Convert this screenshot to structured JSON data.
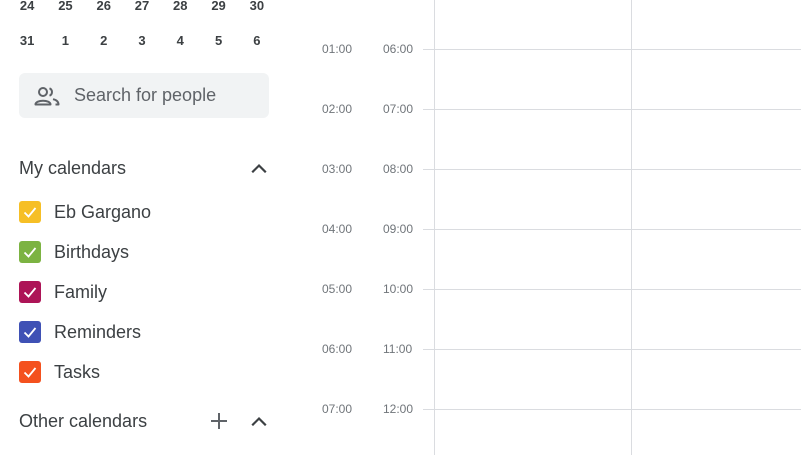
{
  "mini_calendar": {
    "rows": [
      [
        "24",
        "25",
        "26",
        "27",
        "28",
        "29",
        "30"
      ],
      [
        "31",
        "1",
        "2",
        "3",
        "4",
        "5",
        "6"
      ]
    ]
  },
  "search": {
    "placeholder": "Search for people",
    "icon": "people-icon"
  },
  "my_calendars": {
    "title": "My calendars",
    "collapse_icon": "chevron-up-icon",
    "items": [
      {
        "label": "Eb Gargano",
        "color": "#f6bf26",
        "checked": true
      },
      {
        "label": "Birthdays",
        "color": "#7cb342",
        "checked": true
      },
      {
        "label": "Family",
        "color": "#ad1457",
        "checked": true
      },
      {
        "label": "Reminders",
        "color": "#3f51b5",
        "checked": true
      },
      {
        "label": "Tasks",
        "color": "#f4511e",
        "checked": true
      }
    ]
  },
  "other_calendars": {
    "title": "Other calendars",
    "add_icon": "plus-icon",
    "collapse_icon": "chevron-up-icon"
  },
  "time_grid": {
    "primary_times": [
      "01:00",
      "02:00",
      "03:00",
      "04:00",
      "05:00",
      "06:00",
      "07:00"
    ],
    "secondary_times": [
      "06:00",
      "07:00",
      "08:00",
      "09:00",
      "10:00",
      "11:00",
      "12:00"
    ]
  }
}
